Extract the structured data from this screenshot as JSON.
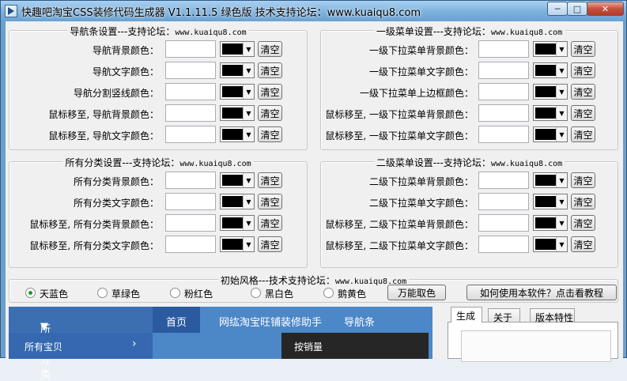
{
  "window": {
    "title": "快趣吧淘宝CSS装修代码生成器 V1.1.11.5 绿色版   技术支持论坛：www.kuaiqu8.com",
    "controls": {
      "minimize": "─",
      "maximize": "□",
      "close": "✕"
    }
  },
  "common": {
    "clear_label": "清空",
    "swatch_color": "#000000",
    "dropdown_arrow": "▼"
  },
  "groups": {
    "nav": {
      "title": "导航条设置---支持论坛：",
      "url": "www.kuaiqu8.com",
      "rows": [
        {
          "label": "导航背景颜色：",
          "value": ""
        },
        {
          "label": "导航文字颜色：",
          "value": ""
        },
        {
          "label": "导航分割竖线颜色：",
          "value": ""
        },
        {
          "label": "鼠标移至, 导航背景颜色：",
          "value": ""
        },
        {
          "label": "鼠标移至, 导航文字颜色：",
          "value": ""
        }
      ]
    },
    "menu1": {
      "title": "一级菜单设置---支持论坛：",
      "url": "www.kuaiqu8.com",
      "rows": [
        {
          "label": "一级下拉菜单背景颜色：",
          "value": ""
        },
        {
          "label": "一级下拉菜单文字颜色：",
          "value": ""
        },
        {
          "label": "一级下拉菜单上边框颜色：",
          "value": ""
        },
        {
          "label": "鼠标移至, 一级下拉菜单背景颜色：",
          "value": ""
        },
        {
          "label": "鼠标移至, 一级下拉菜单文字颜色：",
          "value": ""
        }
      ]
    },
    "allcat": {
      "title": "所有分类设置---支持论坛：",
      "url": "www.kuaiqu8.com",
      "rows": [
        {
          "label": "所有分类背景颜色：",
          "value": ""
        },
        {
          "label": "所有分类文字颜色：",
          "value": ""
        },
        {
          "label": "鼠标移至, 所有分类背景颜色：",
          "value": ""
        },
        {
          "label": "鼠标移至, 所有分类文字颜色：",
          "value": ""
        }
      ]
    },
    "menu2": {
      "title": "二级菜单设置---支持论坛：",
      "url": "www.kuaiqu8.com",
      "rows": [
        {
          "label": "二级下拉菜单背景颜色：",
          "value": ""
        },
        {
          "label": "二级下拉菜单文字颜色：",
          "value": ""
        },
        {
          "label": "鼠标移至, 二级下拉菜单背景颜色：",
          "value": ""
        },
        {
          "label": "鼠标移至, 二级下拉菜单文字颜色：",
          "value": ""
        }
      ]
    }
  },
  "styles": {
    "title": "初始风格---技术支持论坛：",
    "url": "www.kuaiqu8.com",
    "options": [
      "天蓝色",
      "草绿色",
      "粉红色",
      "黑白色",
      "鹅黄色"
    ],
    "selected": "天蓝色",
    "color_picker_button": "万能取色",
    "tutorial_button": "如何使用本软件？点击看教程"
  },
  "preview": {
    "all_categories": "所有分类",
    "all_categories_arrow": "▼",
    "nav_items": [
      "首页",
      "网纮淘宝旺铺装修助手",
      "导航条"
    ],
    "sub_item": "所有宝贝",
    "sub_chevron": "›",
    "dropdown_item": "按销量",
    "colors": {
      "bar": "#4c87c8",
      "active_nav": "#2a5aa0",
      "dropdown": "#262626"
    }
  },
  "tabs": [
    "生成",
    "关于",
    "版本特性"
  ],
  "active_tab": "生成",
  "colors": {
    "title_bar": "#7cb0dc",
    "client_bg": "#f0f0f0",
    "close_button": "#c7503b"
  }
}
